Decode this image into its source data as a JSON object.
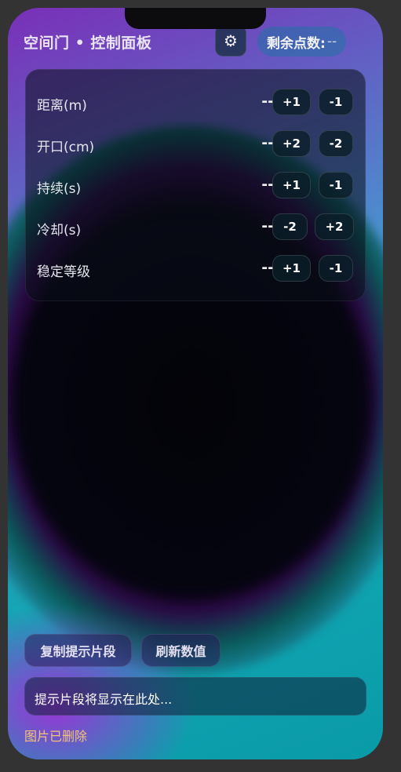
{
  "header": {
    "title": "空间门 • 控制面板",
    "settings_icon": "gear-icon",
    "settings_glyph": "⚙",
    "points_label": "剩余点数:",
    "points_value": "--"
  },
  "controls": [
    {
      "label": "距离(m)",
      "value": "--",
      "btn_a": "+1",
      "btn_b": "-1"
    },
    {
      "label": "开口(cm)",
      "value": "--",
      "btn_a": "+2",
      "btn_b": "-2"
    },
    {
      "label": "持续(s)",
      "value": "--",
      "btn_a": "+1",
      "btn_b": "-1"
    },
    {
      "label": "冷却(s)",
      "value": "--",
      "btn_a": "-2",
      "btn_b": "+2"
    },
    {
      "label": "稳定等级",
      "value": "--",
      "btn_a": "+1",
      "btn_b": "-1"
    }
  ],
  "actions": {
    "copy_label": "复制提示片段",
    "refresh_label": "刷新数值"
  },
  "snippet": {
    "text": "提示片段将显示在此处..."
  },
  "status": {
    "text": "图片已删除",
    "color": "#f4c37a"
  },
  "colors": {
    "page_bg": "#333333",
    "accent_teal": "#12a7b3",
    "accent_purple": "#7a2fb8"
  }
}
